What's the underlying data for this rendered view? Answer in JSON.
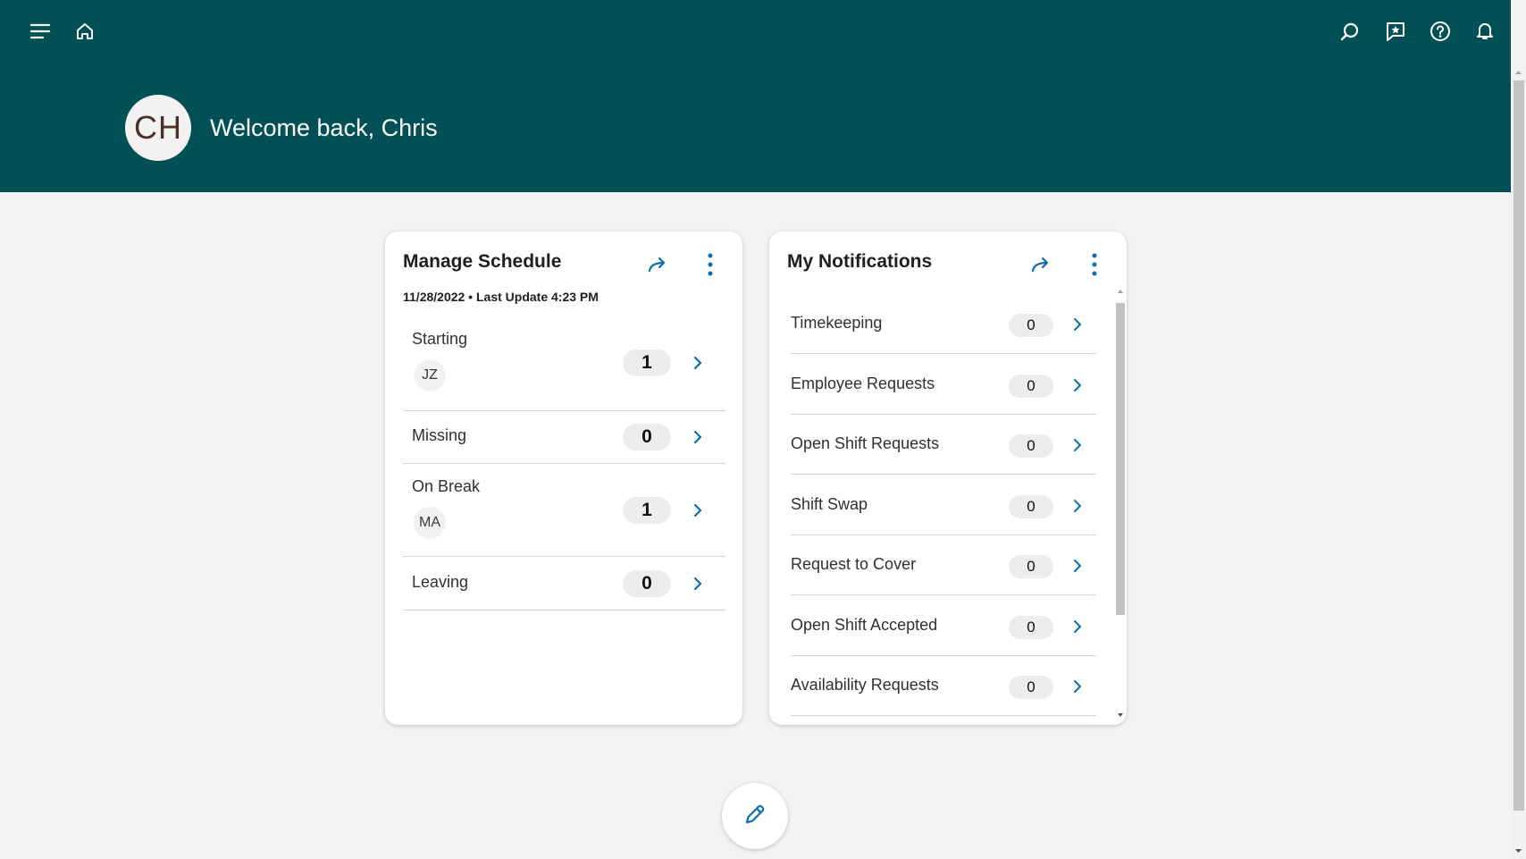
{
  "header": {
    "avatar_initials": "CH",
    "welcome": "Welcome back, Chris",
    "left_icons": [
      "menu-icon",
      "home-icon"
    ],
    "right_icons": [
      "search-icon",
      "feedback-icon",
      "help-icon",
      "bell-icon"
    ],
    "background": "#005055"
  },
  "manage_schedule": {
    "title": "Manage Schedule",
    "subtitle": "11/28/2022 • Last Update 4:23 PM",
    "rows": [
      {
        "label": "Starting",
        "count": "1",
        "initials": "JZ"
      },
      {
        "label": "Missing",
        "count": "0"
      },
      {
        "label": "On Break",
        "count": "1",
        "initials": "MA"
      },
      {
        "label": "Leaving",
        "count": "0"
      }
    ]
  },
  "notifications": {
    "title": "My Notifications",
    "rows": [
      {
        "label": "Timekeeping",
        "count": "0"
      },
      {
        "label": "Employee Requests",
        "count": "0"
      },
      {
        "label": "Open Shift Requests",
        "count": "0"
      },
      {
        "label": "Shift Swap",
        "count": "0"
      },
      {
        "label": "Request to Cover",
        "count": "0"
      },
      {
        "label": "Open Shift Accepted",
        "count": "0"
      },
      {
        "label": "Availability Requests",
        "count": "0"
      }
    ]
  },
  "accent_color": "#0a6fb0",
  "fab_icon": "pencil-icon"
}
